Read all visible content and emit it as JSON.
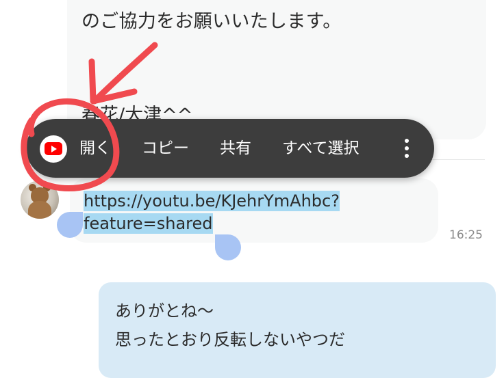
{
  "messages": {
    "top_message": {
      "line1": "のご協力をお願いいたします。",
      "signature": "春花/大津^^"
    },
    "link_message": {
      "line1": "https://youtu.be/KJehrYmAhbc?",
      "line2": "feature=shared",
      "time": "16:25"
    },
    "own_message": {
      "line1": "ありがとね〜",
      "line2": "思ったとおり反転しないやつだ"
    }
  },
  "context_menu": {
    "open_label": "開く",
    "copy_label": "コピー",
    "share_label": "共有",
    "select_all_label": "すべて選択",
    "open_icon": "youtube-icon",
    "more_icon": "more-vertical-icon"
  },
  "colors": {
    "menu_background": "#3d3d3d",
    "selection_highlight": "#a7d9f2",
    "selection_handles": "#a8c4f4",
    "own_bubble": "#d8eaf6",
    "annotation_red": "#f04a4f"
  }
}
